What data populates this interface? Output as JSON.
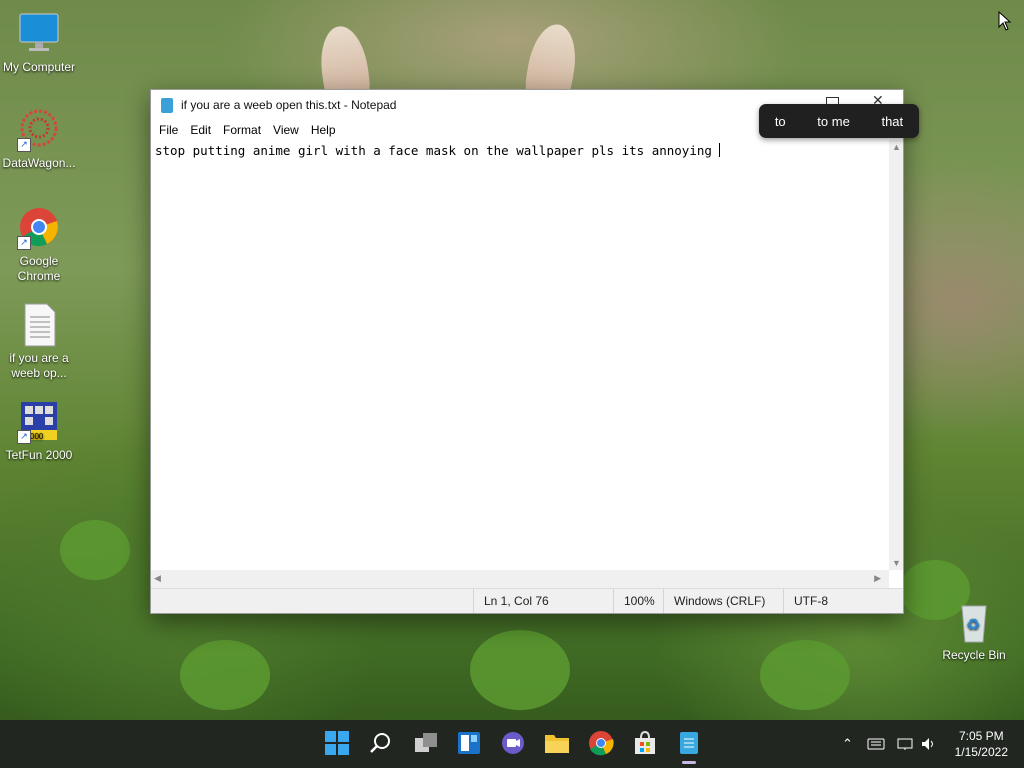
{
  "desktop": {
    "icons": [
      {
        "label": "My Computer"
      },
      {
        "label": "DataWagon..."
      },
      {
        "label": "Google Chrome"
      },
      {
        "label": "if you are a weeb op..."
      },
      {
        "label": "TetFun 2000"
      },
      {
        "label": "Recycle Bin"
      }
    ]
  },
  "notepad": {
    "title": "if you are a weeb open this.txt - Notepad",
    "menu": [
      "File",
      "Edit",
      "Format",
      "View",
      "Help"
    ],
    "content": "stop putting anime girl with a face mask on the wallpaper pls its annoying ",
    "status": {
      "position": "Ln 1, Col 76",
      "zoom": "100%",
      "line_ending": "Windows (CRLF)",
      "encoding": "UTF-8"
    }
  },
  "suggestions": [
    "to",
    "to me",
    "that"
  ],
  "taskbar": {
    "apps": [
      "start-icon",
      "search-icon",
      "task-view-icon",
      "widgets-icon",
      "chat-icon",
      "file-explorer-icon",
      "chrome-icon",
      "store-icon",
      "notepad-icon"
    ],
    "clock": {
      "time": "7:05 PM",
      "date": "1/15/2022"
    }
  },
  "colors": {
    "taskbar": "#202420",
    "window_bg": "#ffffff",
    "accent": "#0078d4"
  }
}
